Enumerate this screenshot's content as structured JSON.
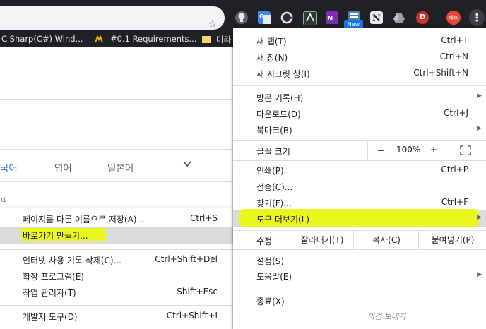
{
  "colors": {
    "toolbar_bg": "#202124",
    "accent_blue": "#1a73e8",
    "highlight_yellow": "#e9f71f",
    "bookmark_underline": "#d81b60",
    "avatar": "#e8453c"
  },
  "toolbar": {
    "star_icon": "☆",
    "new_badge": "New",
    "avatar_text": "태호",
    "menu_icon": "⋮",
    "extensions": [
      "bulb-icon",
      "google-translate-icon",
      "edge-icon",
      "vim-icon",
      "onenote-icon",
      "new-ext-icon",
      "notion-icon",
      "google-drive-icon",
      "d-icon"
    ]
  },
  "bookmarks": [
    {
      "label": "C Sharp(C#) Wind..."
    },
    {
      "label": "#0.1 Requirements..."
    },
    {
      "label": "미라"
    }
  ],
  "page": {
    "lang_tabs": [
      "국어",
      "영어",
      "일본어"
    ],
    "fragment_icon": "¤"
  },
  "main_menu": {
    "new_tab": {
      "label": "새 탭(T)",
      "shortcut": "Ctrl+T"
    },
    "new_window": {
      "label": "새 창(N)",
      "shortcut": "Ctrl+N"
    },
    "new_incognito": {
      "label": "새 시크릿 창(I)",
      "shortcut": "Ctrl+Shift+N"
    },
    "history": {
      "label": "방문 기록(H)"
    },
    "downloads": {
      "label": "다운로드(D)",
      "shortcut": "Ctrl+J"
    },
    "bookmarks": {
      "label": "북마크(B)"
    },
    "zoom": {
      "label": "글꼴 크기",
      "minus": "－",
      "value": "100%",
      "plus": "+"
    },
    "print": {
      "label": "인쇄(P)",
      "shortcut": "Ctrl+P"
    },
    "cast": {
      "label": "전송(C)..."
    },
    "find": {
      "label": "찾기(F)...",
      "shortcut": "Ctrl+F"
    },
    "more_tools": {
      "label": "도구 더보기(L)"
    },
    "edit": {
      "label": "수정",
      "cut": "잘라내기(T)",
      "copy": "복사(C)",
      "paste": "붙여넣기(P)"
    },
    "settings": {
      "label": "설정(S)"
    },
    "help": {
      "label": "도움말(E)"
    },
    "exit": {
      "label": "종료(X)"
    },
    "feedback": "의견 보내기"
  },
  "sub_menu": {
    "save_page": {
      "label": "페이지를 다른 이름으로 저장(A)...",
      "shortcut": "Ctrl+S"
    },
    "create_shortcut": {
      "label": "바로가기 만들기..."
    },
    "clear_data": {
      "label": "인터넷 사용 기록 삭제(C)...",
      "shortcut": "Ctrl+Shift+Del"
    },
    "extensions": {
      "label": "확장 프로그램(E)"
    },
    "task_manager": {
      "label": "작업 관리자(T)",
      "shortcut": "Shift+Esc"
    },
    "dev_tools": {
      "label": "개발자 도구(D)",
      "shortcut": "Ctrl+Shift+I"
    }
  }
}
